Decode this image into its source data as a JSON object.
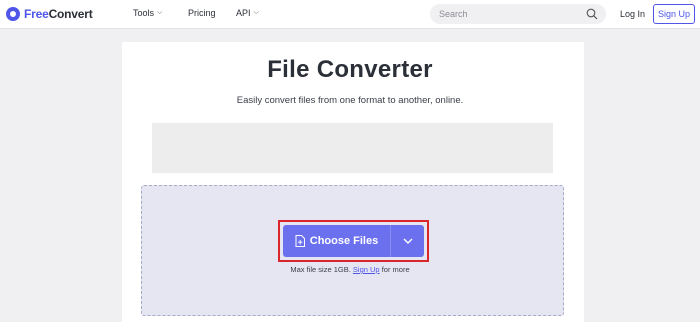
{
  "header": {
    "logo_free": "Free",
    "logo_convert": "Convert",
    "nav": [
      {
        "label": "Tools",
        "has_caret": true
      },
      {
        "label": "Pricing",
        "has_caret": false
      },
      {
        "label": "API",
        "has_caret": true
      }
    ],
    "search_placeholder": "Search",
    "login_label": "Log In",
    "signup_label": "Sign Up"
  },
  "main": {
    "title": "File Converter",
    "subtitle": "Easily convert files from one format to another, online.",
    "choose_files_label": "Choose Files",
    "max_size_prefix": "Max file size 1GB.",
    "max_size_link": "Sign Up",
    "max_size_suffix": "for more"
  },
  "colors": {
    "brand": "#4f56e8",
    "button": "#6b70ef",
    "highlight": "#d9262c"
  },
  "icons": [
    "logo-icon",
    "chevron-down-icon",
    "search-icon",
    "file-plus-icon"
  ]
}
